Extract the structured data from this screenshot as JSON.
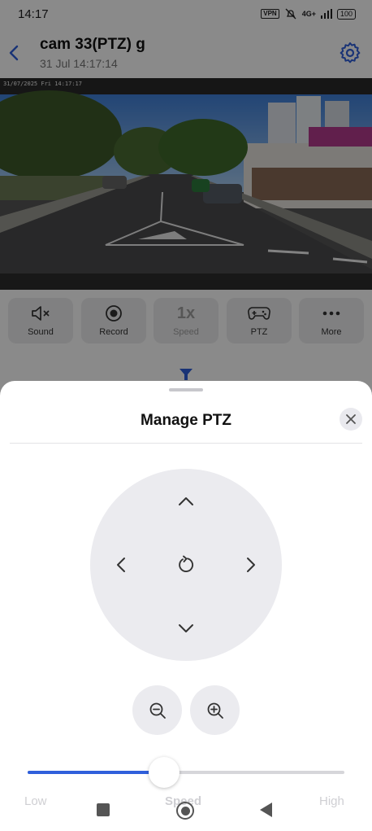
{
  "status_bar": {
    "time": "14:17",
    "vpn": "VPN",
    "network": "4G+",
    "battery": "100"
  },
  "header": {
    "title": "cam 33(PTZ) g",
    "subtitle": "31 Jul 14:17:14"
  },
  "video": {
    "osd_text": "31/07/2025 Fri 14:17:17"
  },
  "toolbar": {
    "sound": "Sound",
    "record": "Record",
    "speed_value": "1x",
    "speed": "Speed",
    "ptz": "PTZ",
    "more": "More"
  },
  "sheet": {
    "title": "Manage PTZ",
    "speed": {
      "low_label": "Low",
      "label": "Speed",
      "high_label": "High",
      "value_fraction": 0.43
    }
  },
  "colors": {
    "accent": "#2f5fdb",
    "pad_bg": "#ebebef",
    "icon": "#333333"
  }
}
